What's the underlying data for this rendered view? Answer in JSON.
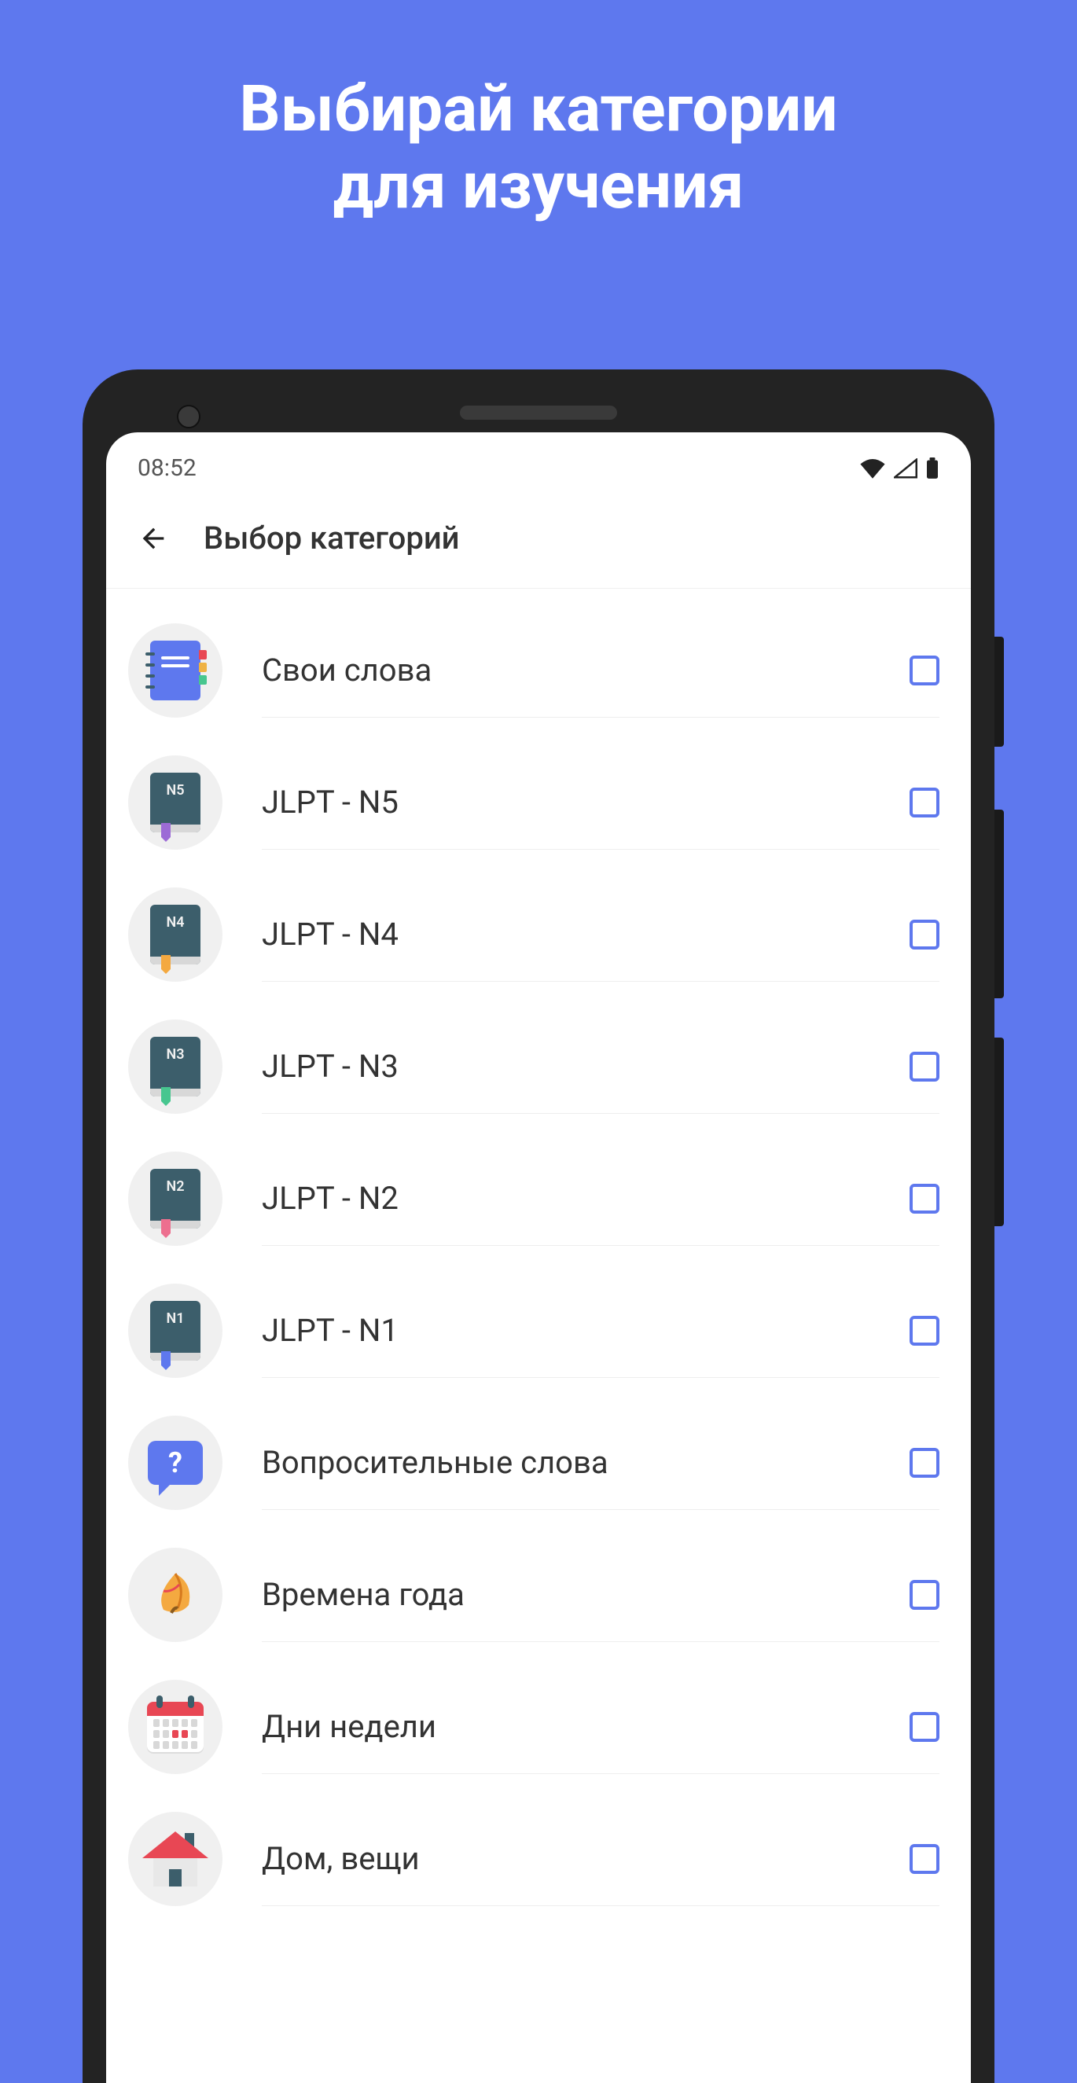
{
  "promo": {
    "title_line1": "Выбирай категории",
    "title_line2": "для изучения"
  },
  "status": {
    "time": "08:52"
  },
  "appbar": {
    "title": "Выбор категорий",
    "back_icon": "back-arrow-icon"
  },
  "categories": [
    {
      "label": "Свои слова",
      "icon": "own-words",
      "level": "",
      "bookmark": "",
      "checked": false
    },
    {
      "label": "JLPT - N5",
      "icon": "jlpt",
      "level": "N5",
      "bookmark": "bm-purple",
      "checked": false
    },
    {
      "label": "JLPT - N4",
      "icon": "jlpt",
      "level": "N4",
      "bookmark": "bm-orange",
      "checked": false
    },
    {
      "label": "JLPT - N3",
      "icon": "jlpt",
      "level": "N3",
      "bookmark": "bm-green",
      "checked": false
    },
    {
      "label": "JLPT - N2",
      "icon": "jlpt",
      "level": "N2",
      "bookmark": "bm-pink",
      "checked": false
    },
    {
      "label": "JLPT - N1",
      "icon": "jlpt",
      "level": "N1",
      "bookmark": "bm-blue",
      "checked": false
    },
    {
      "label": "Вопросительные слова",
      "icon": "question",
      "level": "",
      "bookmark": "",
      "checked": false
    },
    {
      "label": "Времена года",
      "icon": "leaf",
      "level": "",
      "bookmark": "",
      "checked": false
    },
    {
      "label": "Дни недели",
      "icon": "calendar",
      "level": "",
      "bookmark": "",
      "checked": false
    },
    {
      "label": "Дом, вещи",
      "icon": "house",
      "level": "",
      "bookmark": "",
      "checked": false
    }
  ]
}
